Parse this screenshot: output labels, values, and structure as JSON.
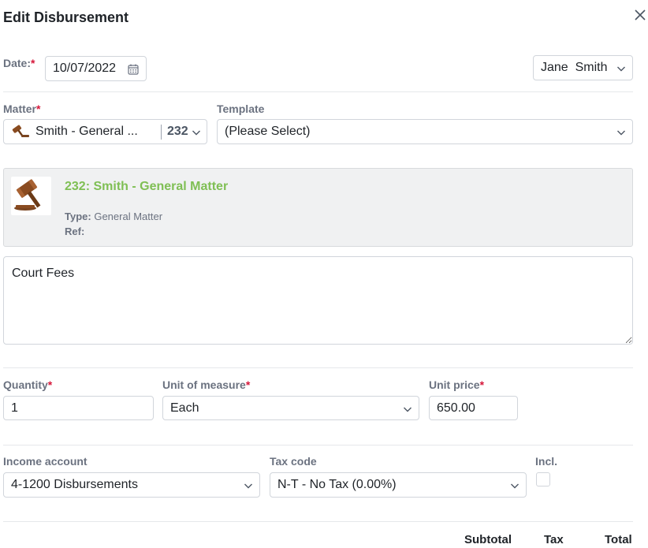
{
  "dialog": {
    "title": "Edit Disbursement"
  },
  "date": {
    "label": "Date:",
    "value": "10/07/2022"
  },
  "user": {
    "value": "Jane  Smith"
  },
  "matter": {
    "label": "Matter",
    "name": "Smith - General ...",
    "number": "232"
  },
  "template": {
    "label": "Template",
    "value": "(Please Select)"
  },
  "matter_card": {
    "title": "232: Smith - General Matter",
    "type_label": "Type:",
    "type_value": "General Matter",
    "ref_label": "Ref:",
    "ref_value": ""
  },
  "description": {
    "value": "Court Fees"
  },
  "quantity": {
    "label": "Quantity",
    "value": "1"
  },
  "unit_of_measure": {
    "label": "Unit of measure",
    "value": "Each"
  },
  "unit_price": {
    "label": "Unit price",
    "value": "650.00"
  },
  "income_account": {
    "label": "Income account",
    "value": "4-1200 Disbursements"
  },
  "tax_code": {
    "label": "Tax code",
    "value": "N-T - No Tax (0.00%)"
  },
  "incl": {
    "label": "Incl.",
    "checked": false
  },
  "totals": {
    "subtotal": "Subtotal",
    "tax": "Tax",
    "total": "Total"
  },
  "required_marker": "*",
  "colors": {
    "required": "#d6173a",
    "matter_title": "#7fbf54",
    "label": "#6b7280"
  }
}
